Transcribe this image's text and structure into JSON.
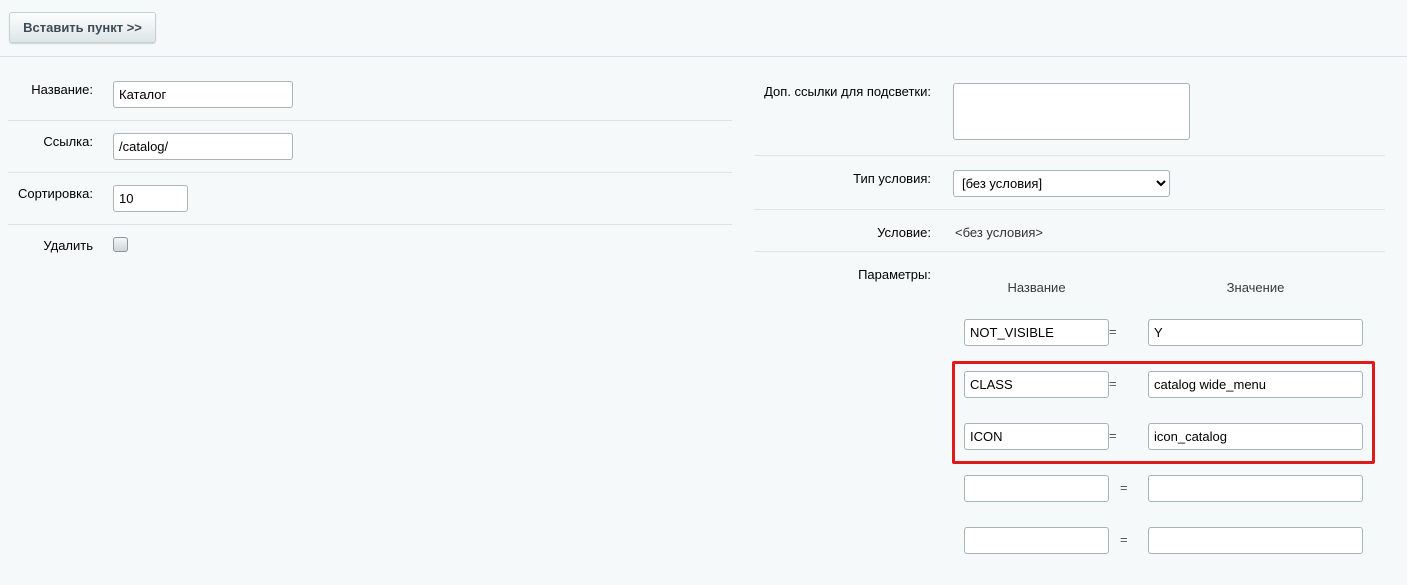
{
  "toolbar": {
    "insert_label": "Вставить пункт >>"
  },
  "left": {
    "name_label": "Название:",
    "name_value": "Каталог",
    "link_label": "Ссылка:",
    "link_value": "/catalog/",
    "sort_label": "Сортировка:",
    "sort_value": "10",
    "delete_label": "Удалить"
  },
  "right": {
    "extra_links_label": "Доп. ссылки для подсветки:",
    "extra_links_value": "",
    "condition_type_label": "Тип условия:",
    "condition_type_value": "[без условия]",
    "condition_label": "Условие:",
    "condition_value": "<без условия>",
    "params_label": "Параметры:",
    "params_header_name": "Название",
    "params_header_value": "Значение",
    "equals_sign": "=",
    "params": [
      {
        "name": "NOT_VISIBLE",
        "value": "Y"
      },
      {
        "name": "CLASS",
        "value": "catalog wide_menu"
      },
      {
        "name": "ICON",
        "value": "icon_catalog"
      },
      {
        "name": "",
        "value": ""
      },
      {
        "name": "",
        "value": ""
      }
    ]
  },
  "colors": {
    "highlight": "#e01a1a"
  }
}
